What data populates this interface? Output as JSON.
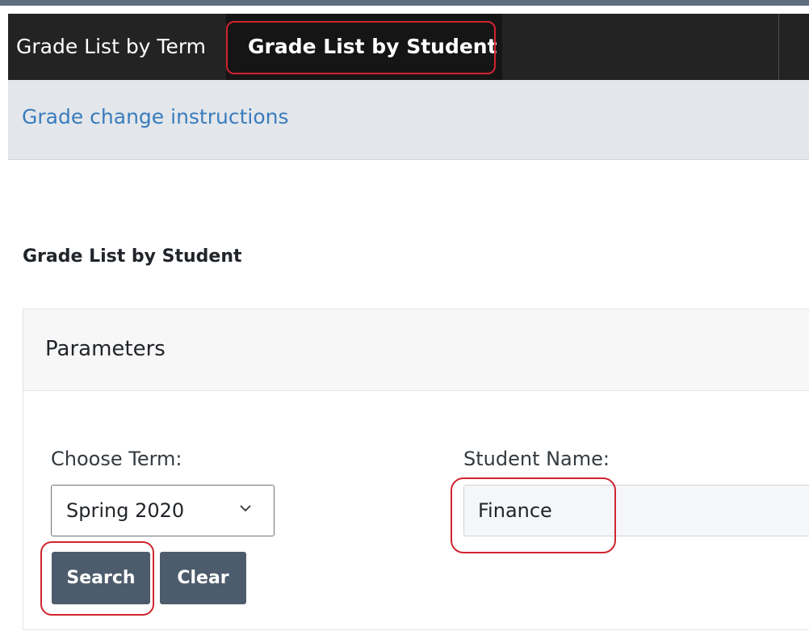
{
  "nav": {
    "tabs": [
      {
        "label": "Grade List by Term"
      },
      {
        "label": "Grade List by Student",
        "active": true
      }
    ]
  },
  "subnav": {
    "link_label": "Grade change instructions"
  },
  "page": {
    "heading": "Grade List by Student"
  },
  "parameters": {
    "title": "Parameters",
    "term": {
      "label": "Choose Term:",
      "selected": "Spring 2020"
    },
    "student": {
      "label": "Student Name:",
      "value": "Finance"
    },
    "buttons": {
      "search_label": "Search",
      "clear_label": "Clear"
    }
  },
  "colors": {
    "navbar": "#232323",
    "active_tab": "#151515",
    "subbar": "#e3e7eb",
    "link": "#3a7cbd",
    "button": "#4d5c6c",
    "highlight": "#d0252f"
  },
  "icons": {
    "select_arrow": "chevron-down-icon"
  }
}
